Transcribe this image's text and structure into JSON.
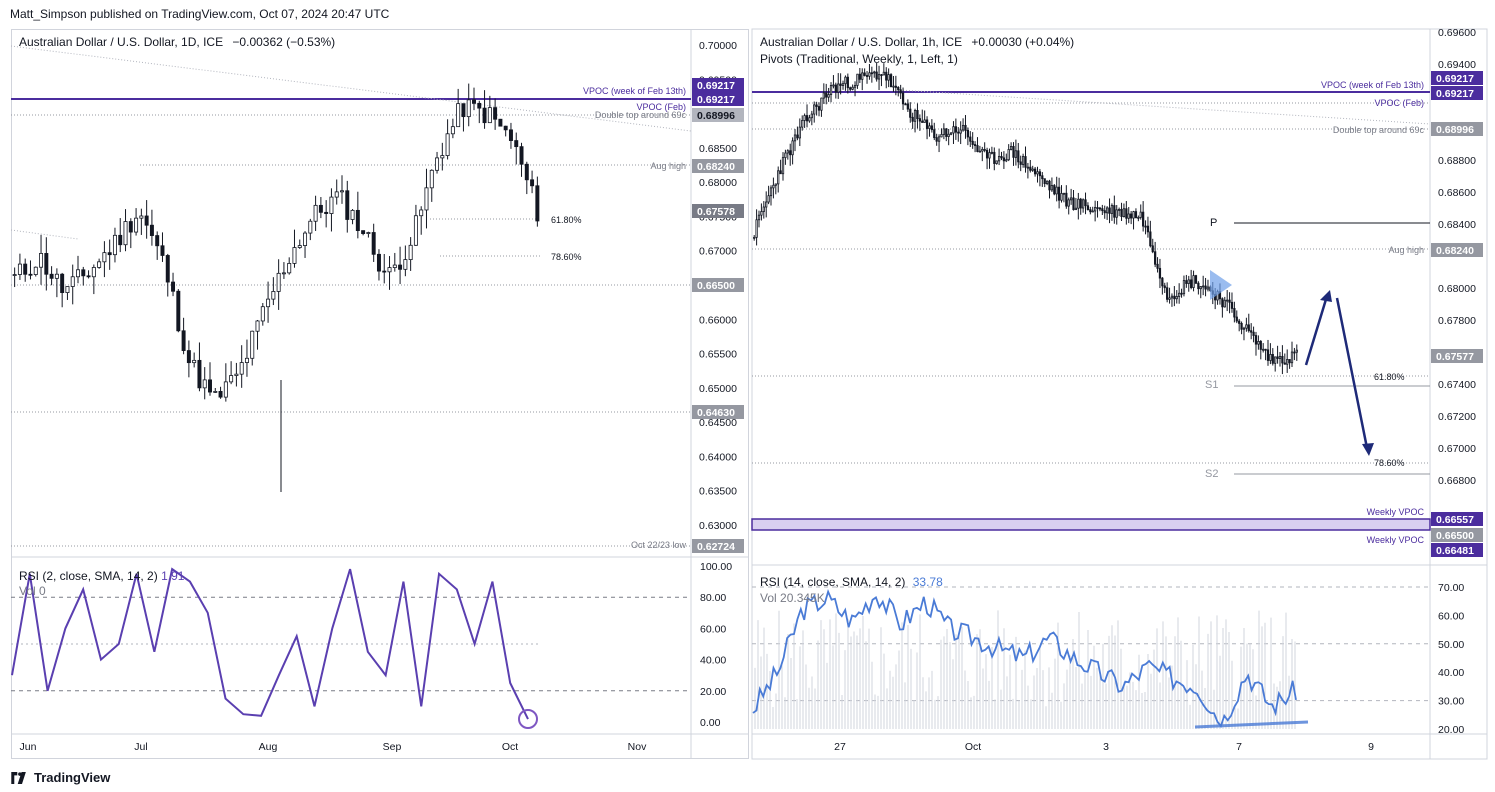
{
  "header": {
    "publisher": "Matt_Simpson published on TradingView.com, Oct 07, 2024 20:47 UTC"
  },
  "footer": {
    "brand": "TradingView"
  },
  "colors": {
    "accent": "#4b2d9e",
    "rsi_left": "#5a3fb0",
    "rsi_right": "#4a7bd6",
    "candle": "#131722",
    "grid": "#b2b5be"
  },
  "left_chart": {
    "legend": "Australian Dollar / U.S. Dollar, 1D, ICE",
    "change": "−0.00362 (−0.53%)",
    "rsi_legend": "RSI (2, close, SMA, 14, 2)",
    "rsi_value": "1.91",
    "vol_legend": "Vol",
    "vol_value": "0",
    "x_labels": [
      "Jun",
      "Jul",
      "Aug",
      "Sep",
      "Oct",
      "Nov"
    ],
    "y_labels": [
      "0.70000",
      "0.69500",
      "0.69000",
      "0.68500",
      "0.68000",
      "0.67500",
      "0.67000",
      "0.66500",
      "0.66000",
      "0.65500",
      "0.65000",
      "0.64500",
      "0.64000",
      "0.63500",
      "0.63000"
    ],
    "rsi_y_labels": [
      "100.00",
      "80.00",
      "60.00",
      "40.00",
      "20.00",
      "0.00"
    ],
    "price_tags": [
      "0.69217",
      "0.69217",
      "0.68996",
      "0.68240",
      "0.67578",
      "0.66500",
      "0.64630",
      "0.62724"
    ],
    "annotations": [
      "VPOC (week of Feb 13th)",
      "VPOC (Feb)",
      "Double top around 69c",
      "Aug high",
      "61.80%",
      "78.60%",
      "Oct 22/23 low"
    ]
  },
  "right_chart": {
    "legend": "Australian Dollar / U.S. Dollar, 1h, ICE",
    "change": "+0.00030 (+0.04%)",
    "pivots_legend": "Pivots (Traditional, Weekly, 1, Left, 1)",
    "rsi_legend": "RSI (14, close, SMA, 14, 2)",
    "rsi_value": "33.78",
    "vol_legend": "Vol",
    "vol_value": "20.345K",
    "x_labels": [
      "27",
      "Oct",
      "3",
      "7",
      "9"
    ],
    "y_labels": [
      "0.69600",
      "0.69400",
      "0.68800",
      "0.68600",
      "0.68400",
      "0.68000",
      "0.67800",
      "0.67400",
      "0.67200",
      "0.67000",
      "0.66800"
    ],
    "rsi_y_labels": [
      "70.00",
      "60.00",
      "50.00",
      "40.00",
      "30.00",
      "20.00"
    ],
    "price_tags": [
      "0.69217",
      "0.69217",
      "0.68996",
      "0.68240",
      "0.67577",
      "0.66557",
      "0.66500",
      "0.66481"
    ],
    "annotations": [
      "VPOC (week of Feb 13th)",
      "VPOC (Feb)",
      "Double top around 69c",
      "Aug high",
      "P",
      "S1",
      "S2",
      "61.80%",
      "78.60%",
      "Weekly VPOC",
      "Weekly VPOC"
    ]
  },
  "chart_data": [
    {
      "type": "candlestick",
      "title": "Australian Dollar / U.S. Dollar, 1D, ICE",
      "x": [
        "Jun",
        "Jul",
        "Aug",
        "Sep",
        "Oct"
      ],
      "ylim": [
        0.625,
        0.7
      ],
      "series": [
        {
          "values": [
            0.666,
            0.669,
            0.664,
            0.667,
            0.671,
            0.676,
            0.668,
            0.654,
            0.648,
            0.652,
            0.661,
            0.669,
            0.675,
            0.678,
            0.673,
            0.666,
            0.672,
            0.684,
            0.691,
            0.69,
            0.686,
            0.6758
          ]
        }
      ],
      "levels": [
        {
          "label": "VPOC (week of Feb 13th)",
          "value": 0.69217
        },
        {
          "label": "Aug high",
          "value": 0.6824
        },
        {
          "label": "61.80%",
          "value": 0.6755
        },
        {
          "label": "78.60%",
          "value": 0.6694
        },
        {
          "label": "Oct 22/23 low",
          "value": 0.62724
        }
      ]
    },
    {
      "type": "line",
      "title": "RSI (2, close, SMA, 14, 2)",
      "ylim": [
        0,
        100
      ],
      "series": [
        {
          "values": [
            30,
            95,
            20,
            60,
            85,
            40,
            50,
            95,
            45,
            98,
            90,
            70,
            15,
            5,
            4,
            30,
            55,
            10,
            60,
            98,
            45,
            30,
            90,
            10,
            95,
            85,
            50,
            90,
            25,
            1.91
          ]
        }
      ]
    },
    {
      "type": "candlestick",
      "title": "Australian Dollar / U.S. Dollar, 1h, ICE",
      "x": [
        "27",
        "Oct",
        "3",
        "7",
        "9"
      ],
      "ylim": [
        0.665,
        0.697
      ],
      "series": [
        {
          "values": [
            0.6835,
            0.6875,
            0.6905,
            0.6925,
            0.693,
            0.6935,
            0.691,
            0.6895,
            0.69,
            0.688,
            0.6885,
            0.687,
            0.6855,
            0.685,
            0.6848,
            0.6845,
            0.6795,
            0.6805,
            0.6795,
            0.6775,
            0.6755,
            0.6758
          ]
        }
      ],
      "levels": [
        {
          "label": "P",
          "value": 0.6841
        },
        {
          "label": "Aug high",
          "value": 0.6824
        },
        {
          "label": "S1",
          "value": 0.6738
        },
        {
          "label": "61.80%",
          "value": 0.6745
        },
        {
          "label": "78.60%",
          "value": 0.6691
        },
        {
          "label": "S2",
          "value": 0.6685
        },
        {
          "label": "Weekly VPOC",
          "value": 0.66557
        },
        {
          "label": "Weekly VPOC",
          "value": 0.66481
        }
      ]
    },
    {
      "type": "line",
      "title": "RSI (14, close, SMA, 14, 2)",
      "ylim": [
        20,
        75
      ],
      "series": [
        {
          "values": [
            27,
            40,
            62,
            66,
            58,
            68,
            57,
            65,
            55,
            52,
            48,
            45,
            52,
            45,
            40,
            35,
            42,
            38,
            35,
            22,
            40,
            28,
            33.78
          ]
        }
      ]
    }
  ]
}
